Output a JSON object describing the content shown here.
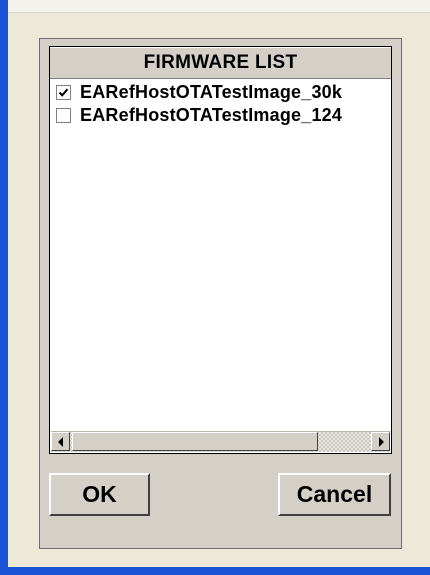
{
  "dialog": {
    "list_header": "FIRMWARE LIST",
    "items": [
      {
        "label": "EARefHostOTATestImage_30k",
        "checked": true
      },
      {
        "label": "EARefHostOTATestImage_124",
        "checked": false
      }
    ],
    "ok_label": "OK",
    "cancel_label": "Cancel"
  },
  "scrollbar": {
    "left_icon": "arrow-left-icon",
    "right_icon": "arrow-right-icon"
  },
  "colors": {
    "frame_border": "#1853d6",
    "dialog_bg": "#d4d0c8",
    "list_bg": "#ffffff"
  }
}
